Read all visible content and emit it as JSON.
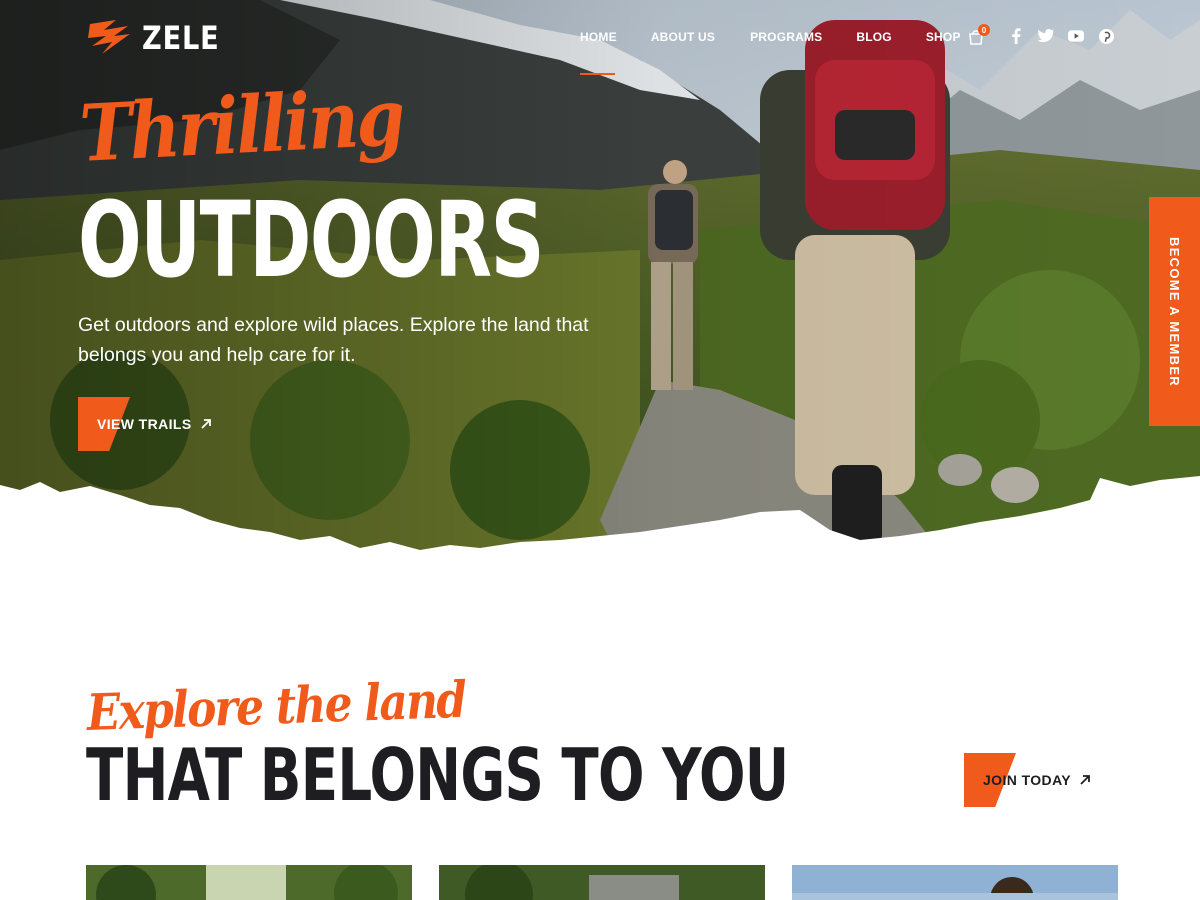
{
  "brand": {
    "name": "ZELE"
  },
  "nav": {
    "items": [
      "HOME",
      "ABOUT US",
      "PROGRAMS",
      "BLOG",
      "SHOP"
    ],
    "active": "HOME",
    "cart_count": "0",
    "socials": [
      "facebook-icon",
      "twitter-icon",
      "youtube-icon",
      "pinterest-icon"
    ]
  },
  "hero": {
    "script_title": "Thrilling",
    "title": "OUTDOORS",
    "description": "Get outdoors and explore wild places. Explore the land that belongs you and help care for it.",
    "cta_label": "VIEW TRAILS"
  },
  "side_tab": {
    "label": "BECOME A MEMBER"
  },
  "section": {
    "script_title": "Explore the land",
    "title": "THAT BELONGS TO YOU",
    "cta_label": "JOIN TODAY"
  },
  "colors": {
    "accent": "#f05a1a",
    "dark": "#1d1d22",
    "white": "#ffffff"
  }
}
